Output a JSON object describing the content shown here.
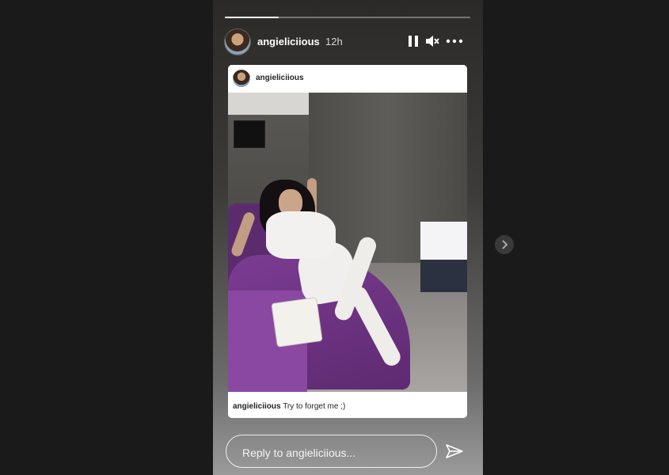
{
  "story": {
    "progress": 0.22,
    "username": "angieliciious",
    "time": "12h",
    "icons": [
      "pause-icon",
      "mute-icon",
      "more-icon"
    ],
    "card": {
      "username": "angieliciious",
      "caption_user": "angieliciious",
      "caption_text": "Try to forget me ;)"
    },
    "reply_placeholder": "Reply to angieliciious...",
    "send_icon": "send-icon",
    "next_icon": "chevron-right-icon"
  }
}
